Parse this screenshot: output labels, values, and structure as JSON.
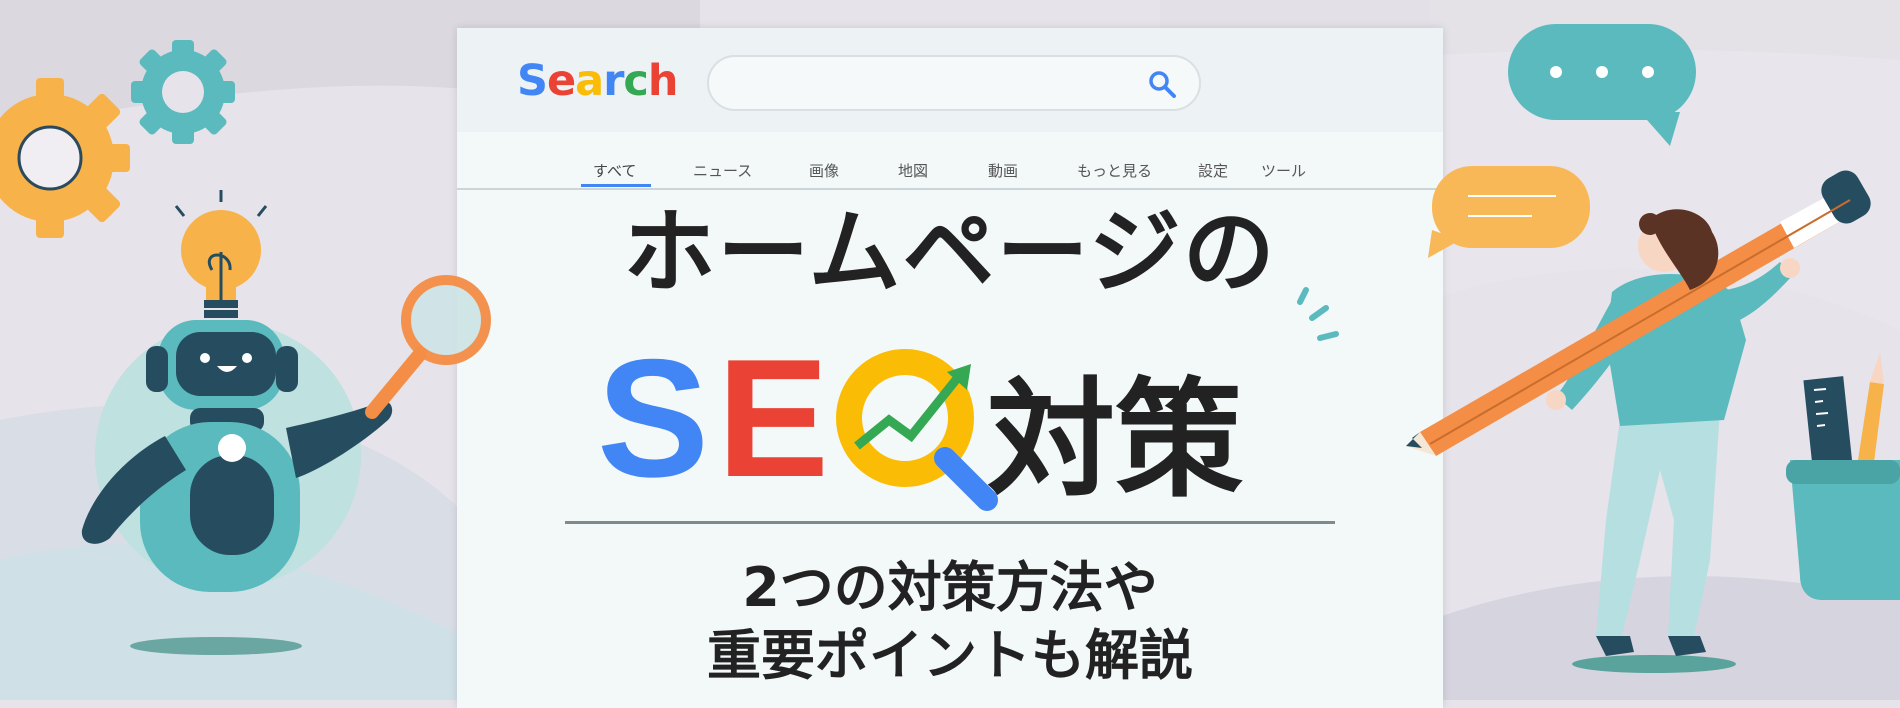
{
  "logo": {
    "letters": [
      "S",
      "e",
      "a",
      "r",
      "c",
      "h"
    ]
  },
  "search": {
    "placeholder": ""
  },
  "tabs": [
    {
      "label": "すべて",
      "active": true
    },
    {
      "label": "ニュース"
    },
    {
      "label": "画像"
    },
    {
      "label": "地図"
    },
    {
      "label": "動画"
    },
    {
      "label": "もっと見る"
    },
    {
      "label": "設定"
    },
    {
      "label": "ツール"
    }
  ],
  "headline": {
    "line1": "ホームページの",
    "seo_s": "S",
    "seo_e": "E",
    "seo_word": "対策",
    "sub_line1": "2つの対策方法や",
    "sub_line2": "重要ポイントも解説"
  },
  "colors": {
    "google_blue": "#4285f4",
    "google_red": "#ea4335",
    "google_yellow": "#fbbc05",
    "google_green": "#34a853",
    "teal": "#5bbabd",
    "dark_navy": "#264d5f",
    "orange": "#f5a25a"
  },
  "icons": [
    "search-icon",
    "gear-icon",
    "lightbulb-icon",
    "magnifier-icon",
    "chat-bubble-icon",
    "pencil-icon",
    "ruler-icon"
  ]
}
